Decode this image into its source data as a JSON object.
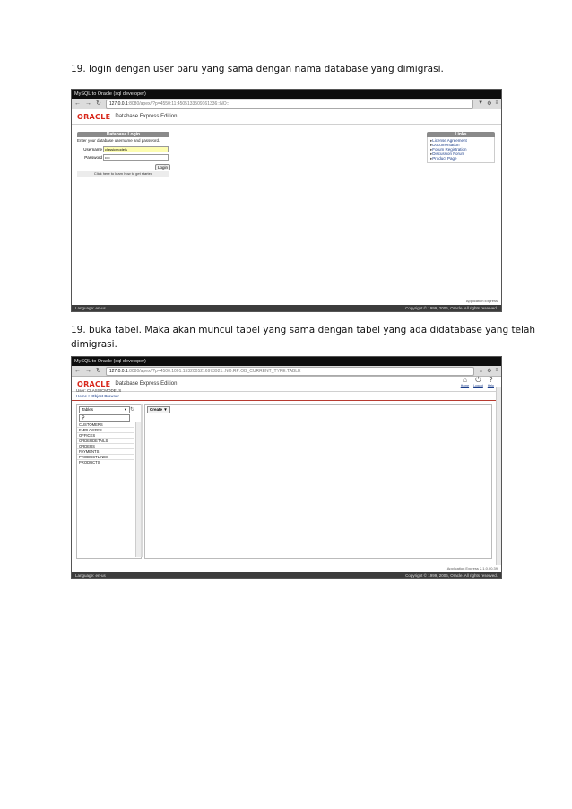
{
  "captions": {
    "first": "19. login dengan user baru yang sama dengan nama database yang dimigrasi.",
    "second_line1": "19. buka tabel. Maka akan muncul tabel yang sama dengan tabel yang ada didatabase yang telah",
    "second_line2": "dimigrasi."
  },
  "browser": {
    "window_title": "MySQL to Oracle (sql developer)",
    "back_icon": "arrow-left-icon",
    "forward_icon": "arrow-right-icon",
    "reload_icon": "reload-icon",
    "url1_host": "127.0.0.1",
    "url1_rest": ":8080/apex/f?p=4550:11:4505133509161336::NO::",
    "url2_host": "127.0.0.1",
    "url2_rest": ":8080/apex/f?p=4500:1001:1532005216973921::NO:RP:OB_CURRENT_TYPE:TABLE"
  },
  "brand": {
    "logo": "ORACLE",
    "edition": "Database Express Edition"
  },
  "login": {
    "title": "Database Login",
    "instruction": "Enter your database username and password.",
    "username_label": "Username",
    "username_value": "classicmodels",
    "password_label": "Password",
    "password_value": "••••",
    "login_button": "Login",
    "hint": "Click here to learn how to get started"
  },
  "links": {
    "title": "Links",
    "items": [
      "License Agreement",
      "Documentation",
      "Forum Registration",
      "Discussion Forum",
      "Product Page"
    ]
  },
  "footer": {
    "app_label": "Application Express",
    "app_version": "Application Express 2.1.0.00.39",
    "language": "Language: en-us",
    "copyright": "Copyright © 1999, 2006, Oracle. All rights reserved."
  },
  "browser_ui": {
    "user_line": "User: CLASSICMODELS",
    "breadcrumb": "Home > Object Browser",
    "toolbar": [
      {
        "icon": "home-icon",
        "label": "Home"
      },
      {
        "icon": "logout-icon",
        "label": "Logout"
      },
      {
        "icon": "help-icon",
        "label": "Help"
      }
    ],
    "object_type": "Tables",
    "create_button": "Create",
    "tables": [
      "CUSTOMERS",
      "EMPLOYEES",
      "OFFICES",
      "ORDERDETAILS",
      "ORDERS",
      "PAYMENTS",
      "PRODUCTLINES",
      "PRODUCTS"
    ]
  }
}
